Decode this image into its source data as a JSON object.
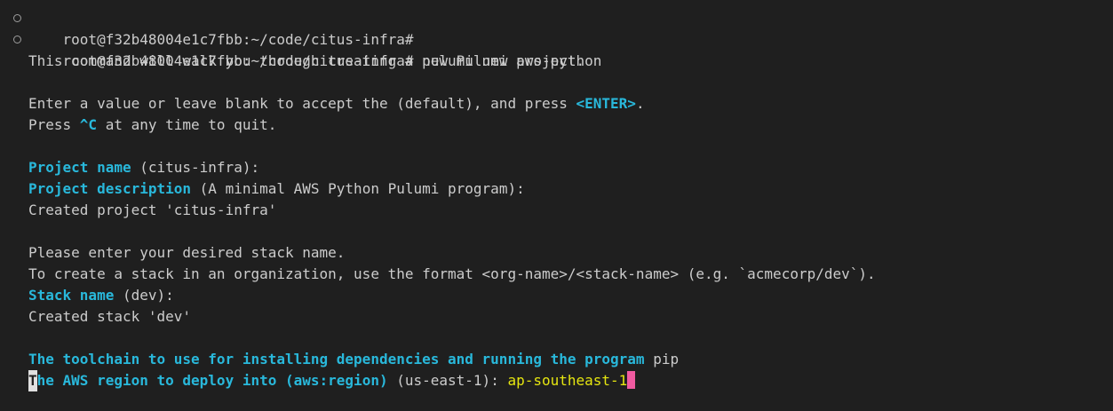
{
  "terminal": {
    "line_1": {
      "prompt": "root@f32b48004e1c7fbb:~/code/citus-infra#"
    },
    "line_2": {
      "prompt": "root@f32b48004e1c7fbb:~/code/citus-infra#",
      "command": " pulumi new aws-python"
    },
    "line_3": "This command will walk you through creating a new Pulumi project.",
    "line_5": {
      "before": "Enter a value or leave blank to accept the (default), and press ",
      "key": "<ENTER>",
      "after": "."
    },
    "line_6": {
      "before": "Press ",
      "key": "^C",
      "after": " at any time to quit."
    },
    "line_8": {
      "label": "Project name",
      "default": " (citus-infra):"
    },
    "line_9": {
      "label": "Project description",
      "default": " (A minimal AWS Python Pulumi program):"
    },
    "line_10": "Created project 'citus-infra'",
    "line_12": "Please enter your desired stack name.",
    "line_13": "To create a stack in an organization, use the format <org-name>/<stack-name> (e.g. `acmecorp/dev`).",
    "line_14": {
      "label": "Stack name",
      "default": " (dev):"
    },
    "line_15": "Created stack 'dev'",
    "line_17": {
      "label": "The toolchain to use for installing dependencies and running the program",
      "answer": " pip"
    },
    "line_18": {
      "label_first_char": "T",
      "label_rest": "he AWS region to deploy into (aws:region)",
      "default": " (us-east-1): ",
      "answer": "ap-southeast-1"
    }
  },
  "colors": {
    "background": "#1f1f1f",
    "text": "#cccccc",
    "keyword": "#29b8db",
    "answer": "#e5e510",
    "cursor": "#f05aa0"
  }
}
